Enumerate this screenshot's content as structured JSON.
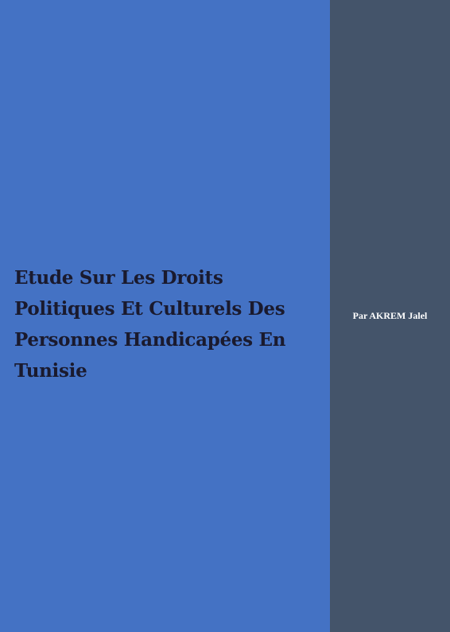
{
  "cover": {
    "title_lines": [
      "Etude Sur Les Droits",
      "Politiques Et Culturels Des",
      "Personnes Handicapées En",
      "Tunisie"
    ],
    "author": "Par AKREM Jalel"
  },
  "colors": {
    "left_panel": "#4472c4",
    "right_panel": "#44546a",
    "title_text": "#1a1a2e",
    "author_text": "#ffffff"
  }
}
